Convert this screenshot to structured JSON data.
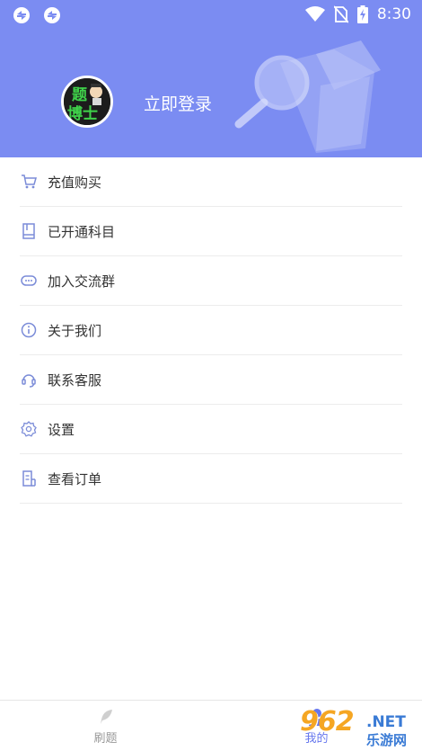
{
  "status_bar": {
    "time": "8:30",
    "icons": [
      "sync-icon",
      "sync-icon",
      "wifi-icon",
      "no-sim-icon",
      "battery-charging-icon"
    ]
  },
  "header": {
    "login_label": "立即登录",
    "avatar_text": "题博士",
    "background_color": "#7b8cf2"
  },
  "menu": {
    "items": [
      {
        "label": "充值购买",
        "icon": "cart-icon"
      },
      {
        "label": "已开通科目",
        "icon": "book-icon"
      },
      {
        "label": "加入交流群",
        "icon": "chat-icon"
      },
      {
        "label": "关于我们",
        "icon": "info-icon"
      },
      {
        "label": "联系客服",
        "icon": "headset-icon"
      },
      {
        "label": "设置",
        "icon": "gear-icon"
      },
      {
        "label": "查看订单",
        "icon": "order-icon"
      }
    ]
  },
  "bottom_nav": {
    "tabs": [
      {
        "label": "刷题",
        "icon": "feather-icon",
        "active": false
      },
      {
        "label": "我的",
        "icon": "user-icon",
        "active": true
      }
    ]
  },
  "watermark": {
    "number": "962",
    "net": ".NET",
    "site_cn": "乐游网"
  },
  "colors": {
    "accent": "#6677ee",
    "icon": "#7b8cd8"
  }
}
